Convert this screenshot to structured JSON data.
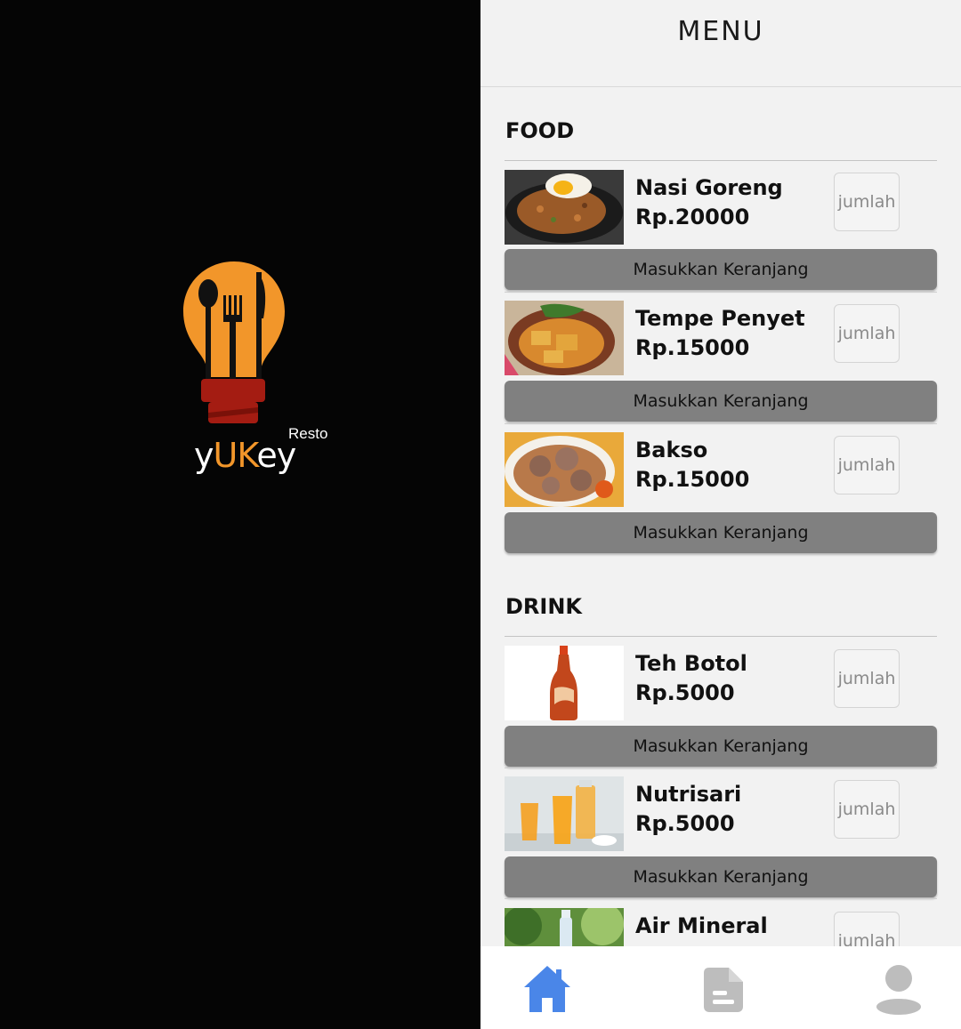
{
  "splash": {
    "brand_prefix": "y",
    "brand_mid": "UK",
    "brand_suffix": "ey",
    "brand_sub": "Resto"
  },
  "header": {
    "title": "MENU"
  },
  "sections": {
    "food": {
      "title": "FOOD"
    },
    "drink": {
      "title": "DRINK"
    }
  },
  "items": [
    {
      "name": "Nasi Goreng",
      "price": "Rp.20000",
      "qty_placeholder": "jumlah",
      "button": "Masukkan Keranjang"
    },
    {
      "name": "Tempe Penyet",
      "price": "Rp.15000",
      "qty_placeholder": "jumlah",
      "button": "Masukkan Keranjang"
    },
    {
      "name": "Bakso",
      "price": "Rp.15000",
      "qty_placeholder": "jumlah",
      "button": "Masukkan Keranjang"
    },
    {
      "name": "Teh Botol",
      "price": "Rp.5000",
      "qty_placeholder": "jumlah",
      "button": "Masukkan Keranjang"
    },
    {
      "name": "Nutrisari",
      "price": "Rp.5000",
      "qty_placeholder": "jumlah",
      "button": "Masukkan Keranjang"
    },
    {
      "name": "Air Mineral",
      "qty_placeholder": "jumlah"
    }
  ],
  "nav": {
    "items": [
      {
        "icon": "home-icon",
        "active": true
      },
      {
        "icon": "document-icon",
        "active": false
      },
      {
        "icon": "user-icon",
        "active": false
      }
    ]
  },
  "colors": {
    "brand_orange": "#f2962a",
    "brand_red": "#a41c12",
    "button_gray": "#808080",
    "nav_active": "#4a86e8",
    "nav_inactive": "#bdbdbd"
  }
}
